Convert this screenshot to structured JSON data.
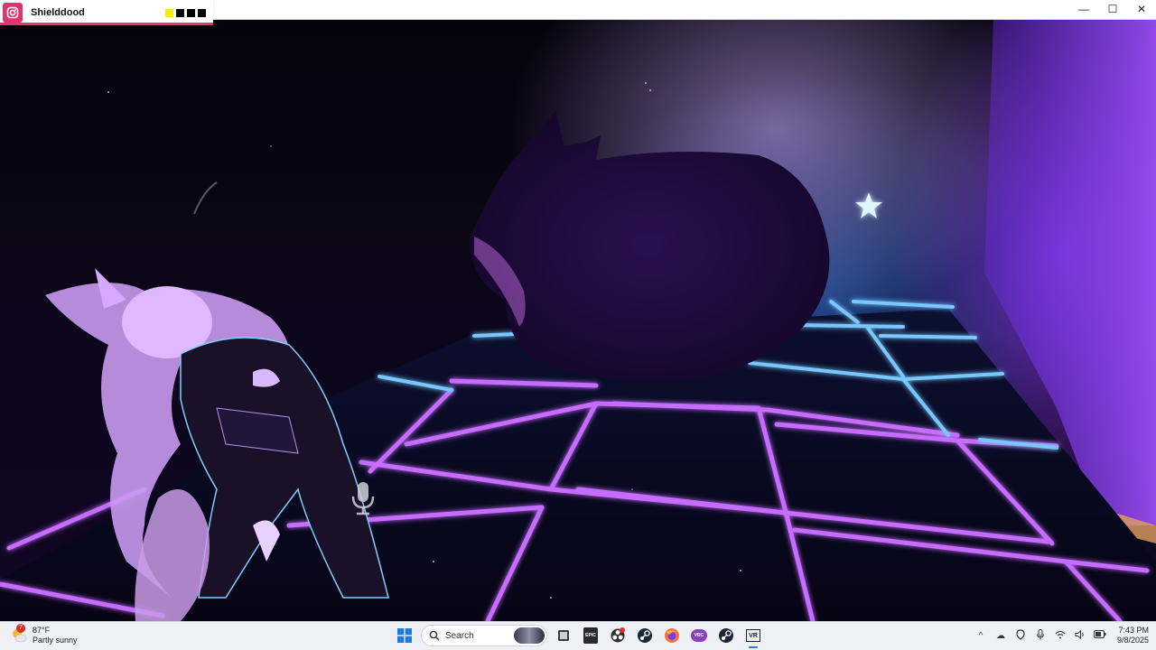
{
  "window": {
    "app_title": "Shielddood",
    "accent_color": "#e3336e",
    "indicator_colors": [
      "#f5f000",
      "#000000",
      "#000000",
      "#000000"
    ],
    "controls": {
      "minimize": "—",
      "maximize": "☐",
      "close": "✕"
    }
  },
  "scene": {
    "icons": [
      "microphone-icon",
      "star-icon"
    ]
  },
  "taskbar": {
    "weather": {
      "temp": "87°F",
      "desc": "Partly sunny",
      "badge": "7"
    },
    "search_label": "Search",
    "apps": [
      "start-icon",
      "search-icon",
      "file-manager-icon",
      "epic-games-icon",
      "obs-icon",
      "steam-icon",
      "firefox-icon",
      "vrchat-icon",
      "steam-icon",
      "vr-icon"
    ],
    "vr_label": "VR",
    "epic_label": "EPIC",
    "vrc_label": "VRC",
    "clock": {
      "time": "7:43 PM",
      "date": "9/8/2025"
    }
  }
}
